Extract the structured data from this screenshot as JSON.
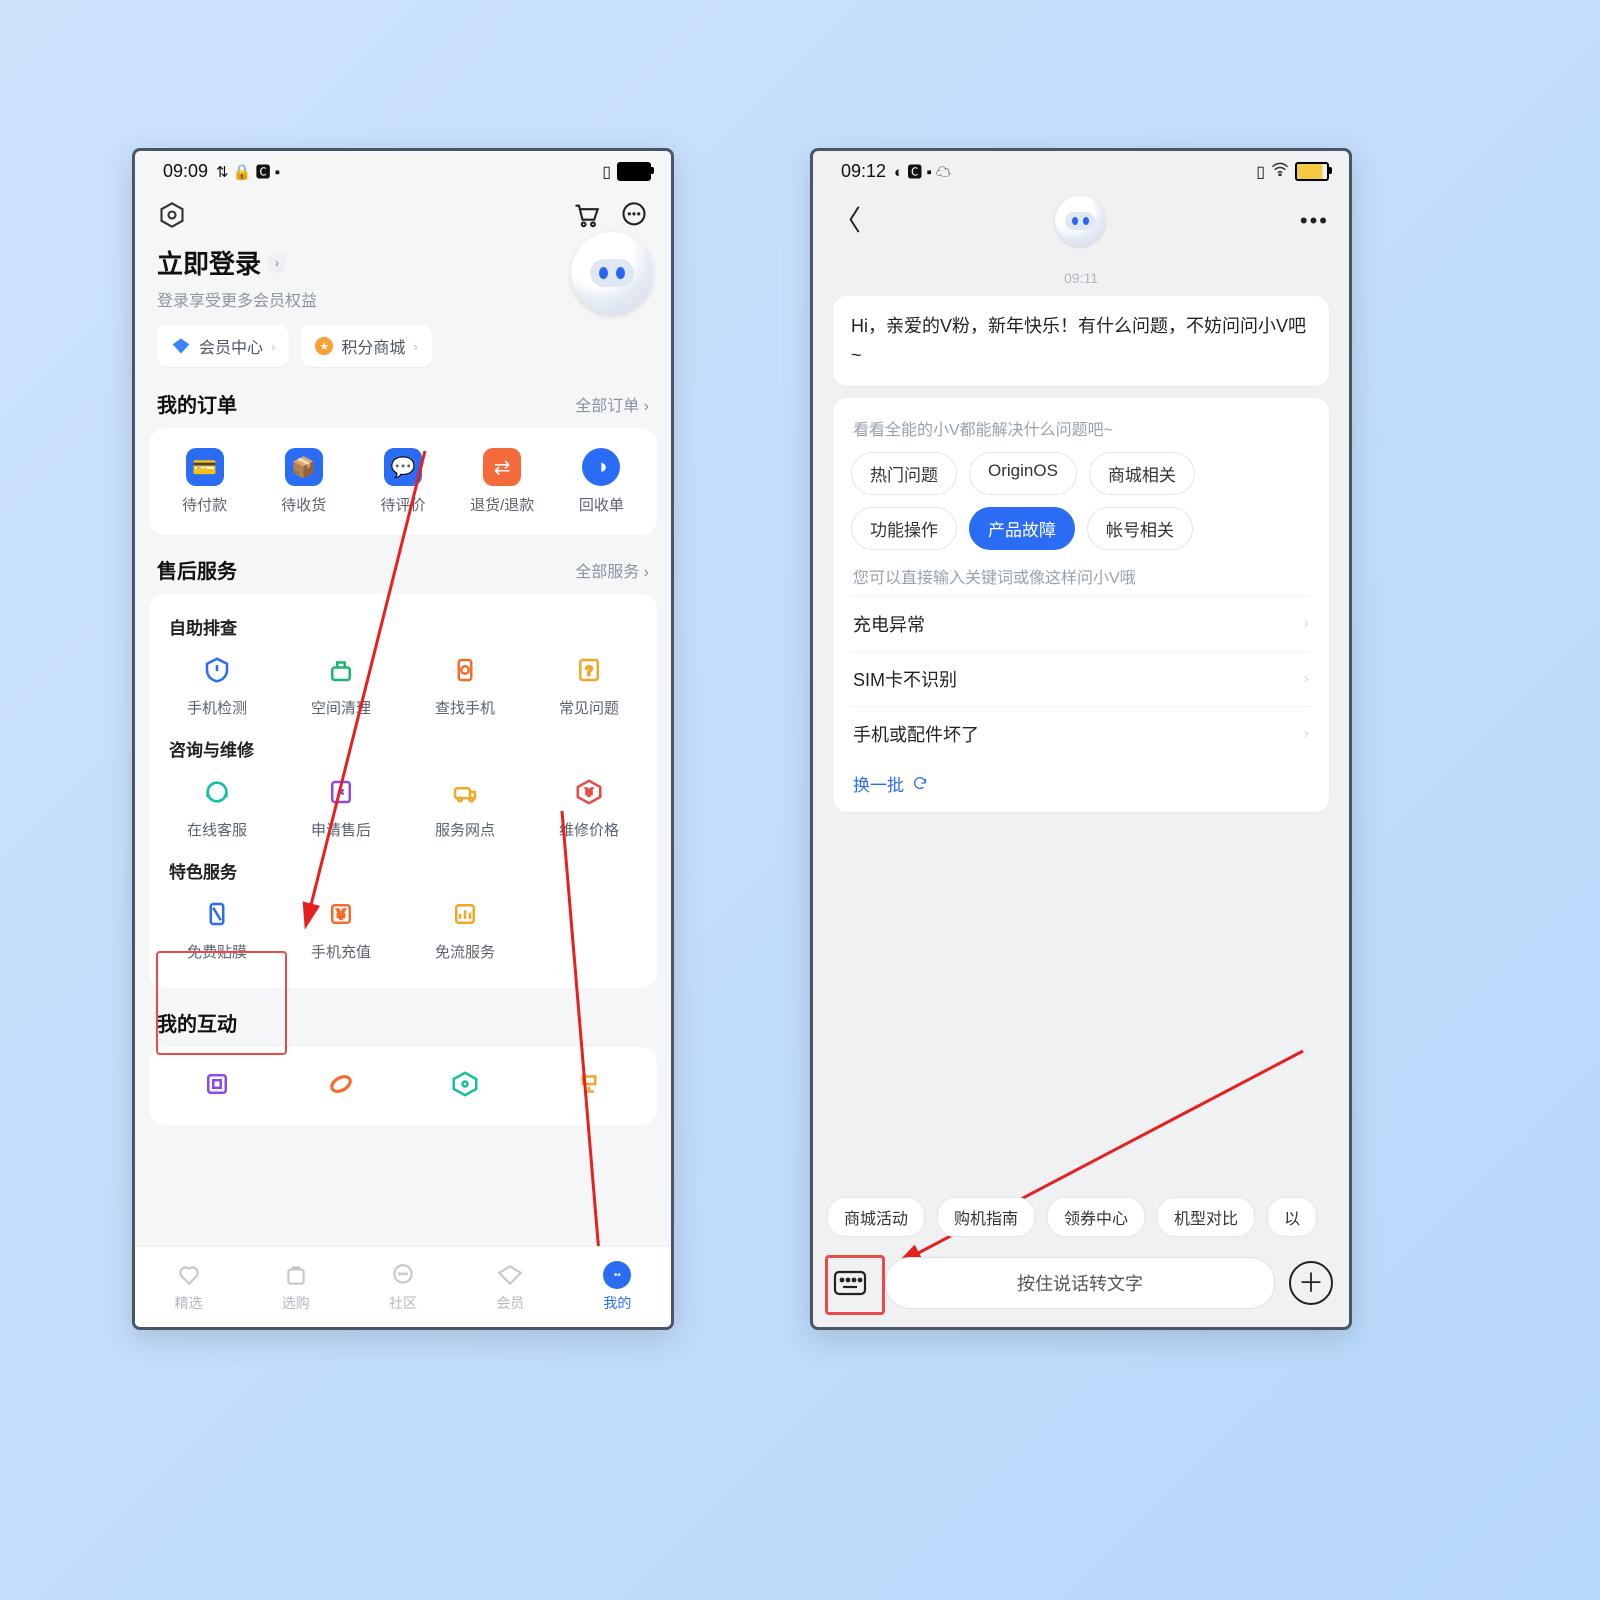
{
  "left": {
    "status": {
      "time": "09:09",
      "icons": "↕ ⚙ 🅲 ⬛"
    },
    "login": {
      "title": "立即登录",
      "sub": "登录享受更多会员权益"
    },
    "chips": {
      "member": "会员中心",
      "points": "积分商城"
    },
    "orders": {
      "title": "我的订单",
      "more": "全部订单",
      "items": [
        "待付款",
        "待收货",
        "待评价",
        "退货/退款",
        "回收单"
      ]
    },
    "service": {
      "title": "售后服务",
      "more": "全部服务",
      "g1_title": "自助排查",
      "g1": [
        "手机检测",
        "空间清理",
        "查找手机",
        "常见问题"
      ],
      "g2_title": "咨询与维修",
      "g2": [
        "在线客服",
        "申请售后",
        "服务网点",
        "维修价格"
      ],
      "g3_title": "特色服务",
      "g3": [
        "免费贴膜",
        "手机充值",
        "免流服务"
      ]
    },
    "interact_title": "我的互动",
    "nav": [
      "精选",
      "选购",
      "社区",
      "会员",
      "我的"
    ]
  },
  "right": {
    "status": {
      "time": "09:12"
    },
    "time_mark": "09:11",
    "greeting": "Hi，亲爱的V粉，新年快乐！有什么问题，不妨问问小V吧~",
    "panel": {
      "hint1": "看看全能的小V都能解决什么问题吧~",
      "pills": [
        "热门问题",
        "OriginOS",
        "商城相关",
        "功能操作",
        "产品故障",
        "帐号相关"
      ],
      "active_pill_index": 4,
      "hint2": "您可以直接输入关键词或像这样问小V哦",
      "list": [
        "充电异常",
        "SIM卡不识别",
        "手机或配件坏了"
      ],
      "refresh": "换一批"
    },
    "suggestions": [
      "商城活动",
      "购机指南",
      "领券中心",
      "机型对比",
      "以"
    ],
    "voice_placeholder": "按住说话转文字"
  }
}
